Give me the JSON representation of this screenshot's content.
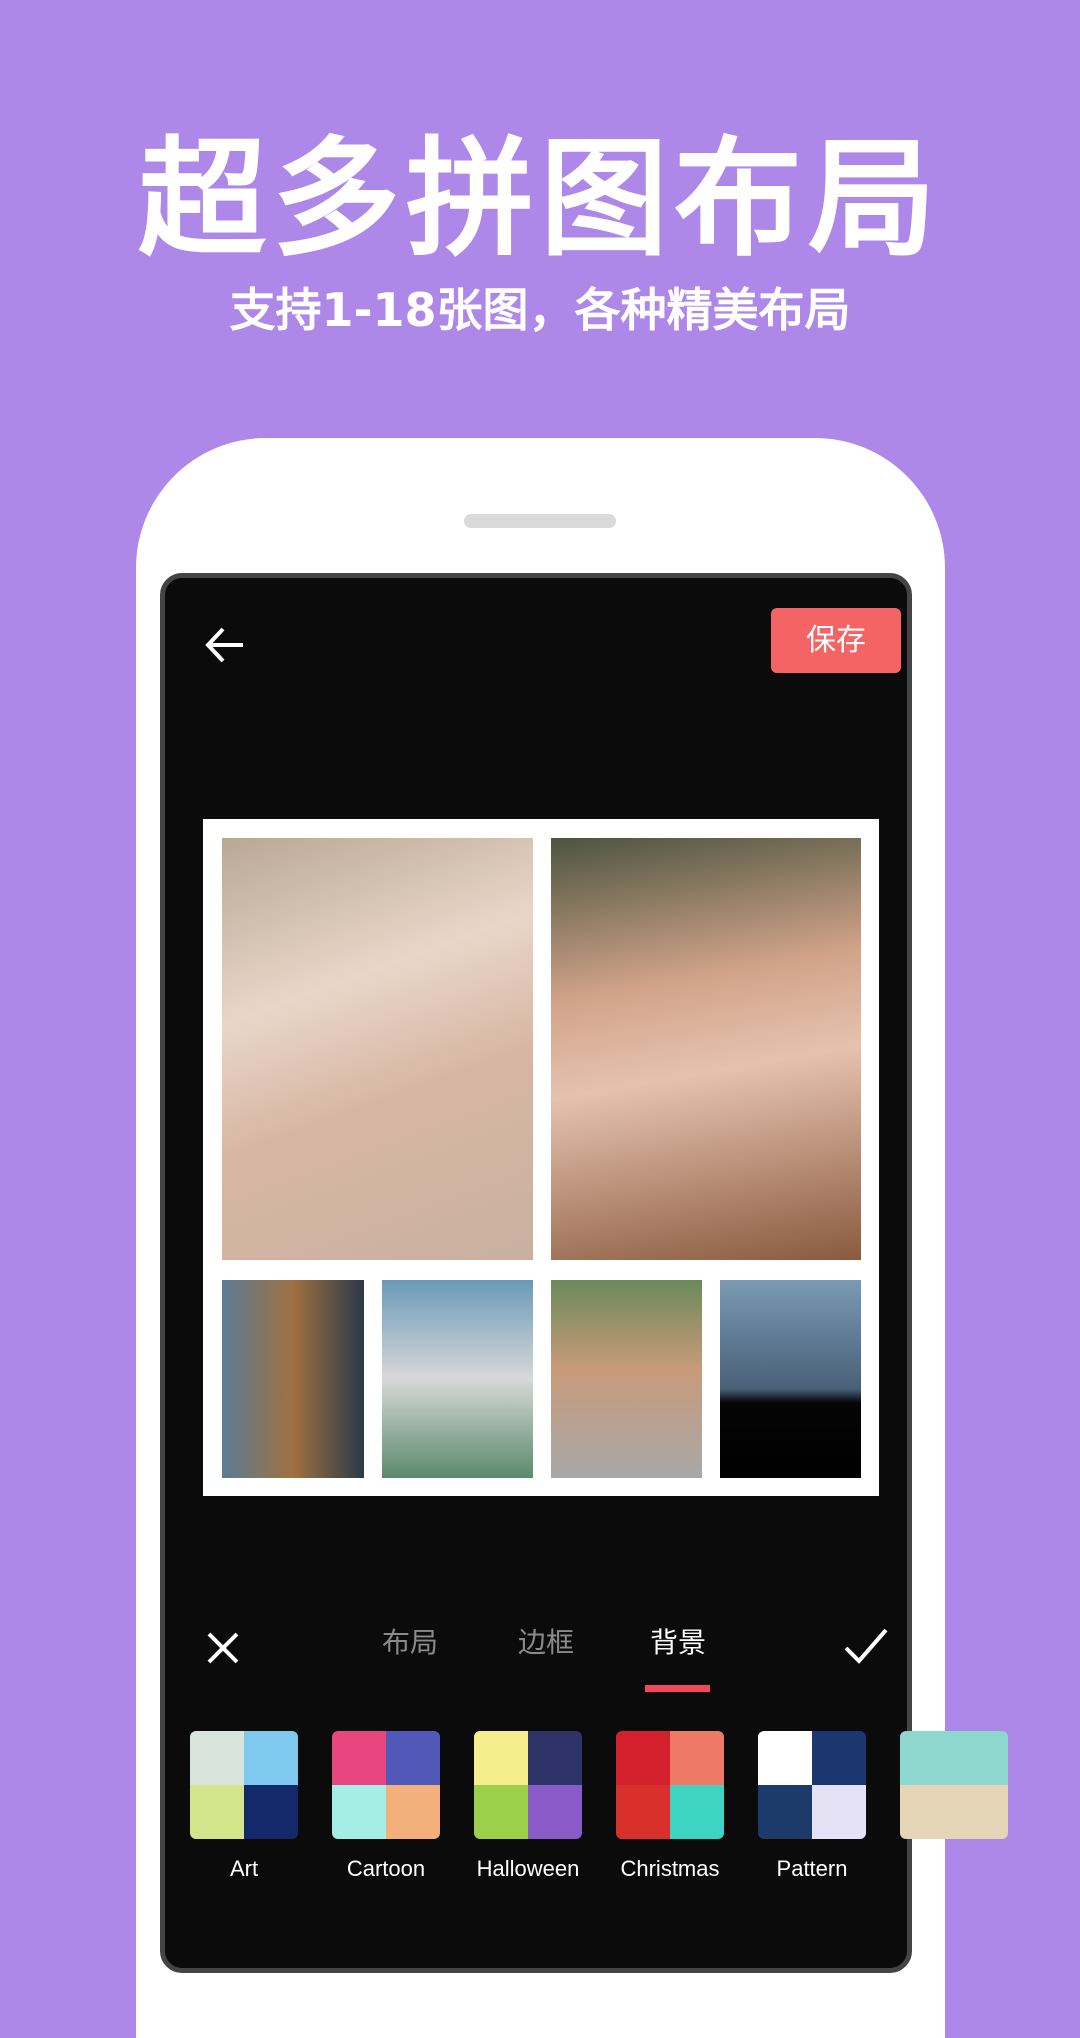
{
  "banner": {
    "title": "超多拼图布局",
    "subtitle": "支持1-18张图，各种精美布局"
  },
  "toolbar": {
    "back_icon": "arrow-left-icon",
    "save_label": "保存"
  },
  "collage": {
    "photo_count": 6
  },
  "bottom_bar": {
    "close_icon": "close-icon",
    "confirm_icon": "check-icon",
    "tabs": [
      {
        "label": "布局",
        "active": false
      },
      {
        "label": "边框",
        "active": false
      },
      {
        "label": "背景",
        "active": true
      }
    ],
    "accent_color": "#f2465a"
  },
  "backgrounds": [
    {
      "label": "Art",
      "colors": [
        "#d8e4dc",
        "#7fc8ee",
        "#d4e48a",
        "#14296a"
      ]
    },
    {
      "label": "Cartoon",
      "colors": [
        "#e8467e",
        "#5058b8",
        "#a4eee6",
        "#f3b07a"
      ]
    },
    {
      "label": "Halloween",
      "colors": [
        "#f6ee8c",
        "#2e3468",
        "#9ad04a",
        "#8a5ac8"
      ]
    },
    {
      "label": "Christmas",
      "colors": [
        "#d4202c",
        "#ee7a66",
        "#d8302a",
        "#3ed4c4"
      ]
    },
    {
      "label": "Pattern",
      "colors": [
        "#ffffff",
        "#1c3670",
        "#1c3a6a",
        "#e4e2f4"
      ]
    },
    {
      "label": "",
      "colors": [
        "#8ed8d0",
        "#8ed8d0",
        "#e6d6b8",
        "#e6d6b8"
      ]
    }
  ]
}
